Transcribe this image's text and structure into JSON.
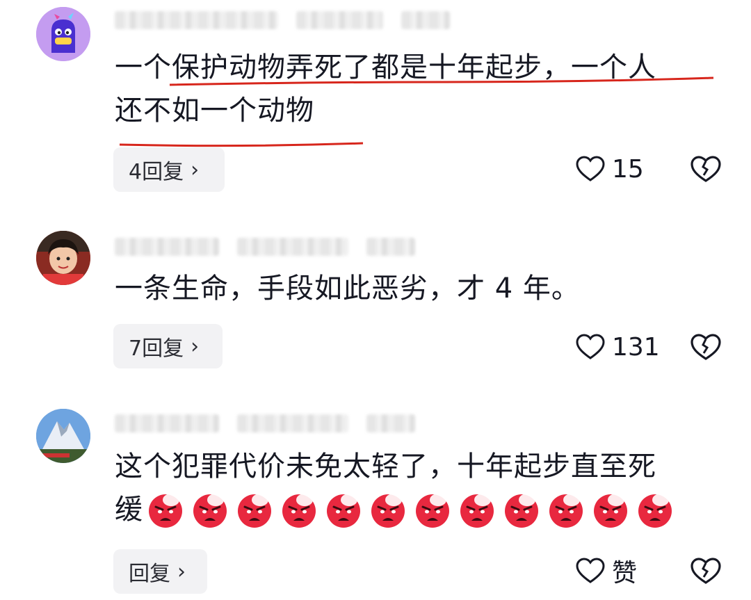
{
  "comments": [
    {
      "text_line1": "一个保护动物弄死了都是十年起步，一个人",
      "text_line2": "还不如一个动物",
      "reply_label": "4回复",
      "like_count": "15"
    },
    {
      "text_line1": "一条生命，手段如此恶劣，才 4 年。",
      "reply_label": "7回复",
      "like_count": "131"
    },
    {
      "text_line1": "这个犯罪代价未免太轻了，十年起步直至死",
      "text_line2": "缓",
      "emoji_count": 12,
      "emoji_name": "angry-face-emoji",
      "reply_label": "回复",
      "like_count": "赞"
    }
  ],
  "icons": {
    "like": "heart-outline-icon",
    "dislike": "broken-heart-icon",
    "reply_arrow": "chevron-right-icon"
  },
  "colors": {
    "underline": "#d7261c",
    "pill_bg": "#f2f2f4",
    "emoji_red": "#e8283f"
  }
}
